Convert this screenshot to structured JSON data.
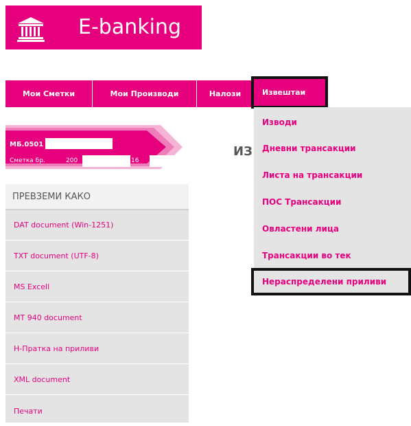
{
  "header": {
    "brand": "E-banking",
    "logo_icon": "bank-building-icon"
  },
  "nav": {
    "tabs": [
      "Мои Сметки",
      "Мои Производи",
      "Налози"
    ],
    "active_tab": "Извештаи"
  },
  "dropdown": {
    "items": [
      "Изводи",
      "Дневни трансакции",
      "Листа на трансакции",
      "ПОС Трансакции",
      "Овластени лица",
      "Трансакции во тек",
      "Нераспределени приливи"
    ]
  },
  "account": {
    "code": "МБ.0501",
    "number_label": "Сметка бр.",
    "number_start": "200",
    "number_end": "16"
  },
  "page_heading": "ИЗ",
  "download": {
    "title": "ПРЕВЗЕМИ КАКО",
    "options": [
      "DAT document (Win-1251)",
      "TXT document (UTF-8)",
      "MS Excell",
      "MT 940 document",
      "Н-Пратка на приливи",
      "XML document",
      "Печати"
    ]
  },
  "colors": {
    "brand": "#e6007e",
    "panel": "#e4e4e4",
    "highlight_border": "#111111"
  }
}
